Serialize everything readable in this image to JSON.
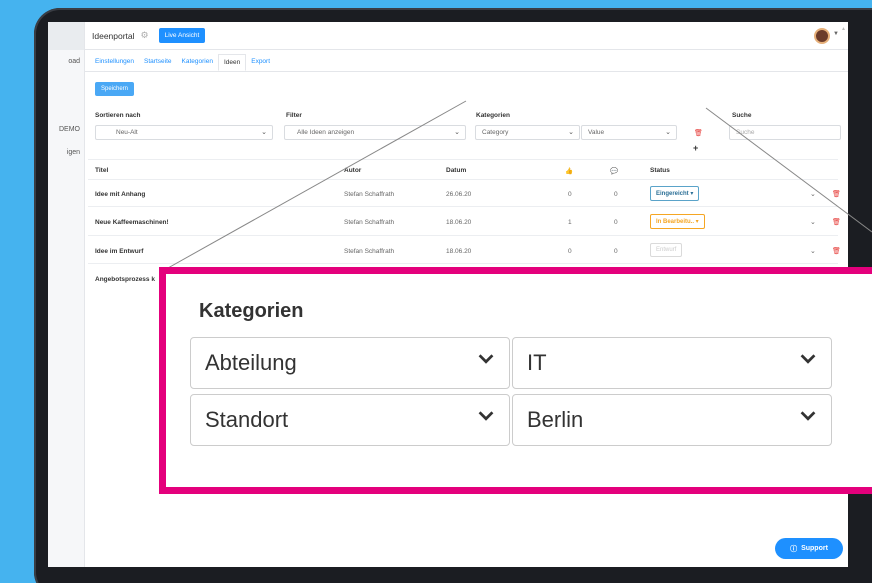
{
  "sidebar": {
    "items": [
      "oad",
      "DEMO",
      "igen"
    ]
  },
  "topbar": {
    "title": "Ideenportal",
    "live_button": "Live Ansicht"
  },
  "tabs": [
    "Einstellungen",
    "Startseite",
    "Kategorien",
    "Ideen",
    "Export"
  ],
  "active_tab": "Ideen",
  "save_button": "Speichern",
  "filters": {
    "sort_label": "Sortieren nach",
    "sort_value": "Neu-Alt",
    "filter_label": "Filter",
    "filter_value": "Alle Ideen anzeigen",
    "categories_label": "Kategorien",
    "category_value": "Category",
    "value_value": "Value",
    "search_label": "Suche",
    "search_placeholder": "Suche"
  },
  "table": {
    "headers": {
      "title": "Titel",
      "author": "Autor",
      "date": "Datum",
      "status": "Status"
    },
    "rows": [
      {
        "title": "Idee mit Anhang",
        "author": "Stefan Schaffrath",
        "date": "26.06.20",
        "likes": "0",
        "comments": "0",
        "status": "Eingereicht"
      },
      {
        "title": "Neue Kaffeemaschinen!",
        "author": "Stefan Schaffrath",
        "date": "18.06.20",
        "likes": "1",
        "comments": "0",
        "status": "In Bearbeitu.."
      },
      {
        "title": "Idee im Entwurf",
        "author": "Stefan Schaffrath",
        "date": "18.06.20",
        "likes": "0",
        "comments": "0",
        "status": "Entwurf"
      },
      {
        "title": "Angebotsprozess k",
        "author": "",
        "date": "",
        "likes": "",
        "comments": "",
        "status": ""
      }
    ]
  },
  "support_button": "Support",
  "zoom": {
    "title": "Kategorien",
    "rows": [
      {
        "category": "Abteilung",
        "value": "IT"
      },
      {
        "category": "Standort",
        "value": "Berlin"
      }
    ]
  },
  "colors": {
    "background": "#45b3ef",
    "accent": "#1e90ff",
    "highlight_border": "#e4007c",
    "status_submitted": "#2b6f96",
    "status_in_progress": "#f5a623",
    "delete": "#e53935"
  }
}
